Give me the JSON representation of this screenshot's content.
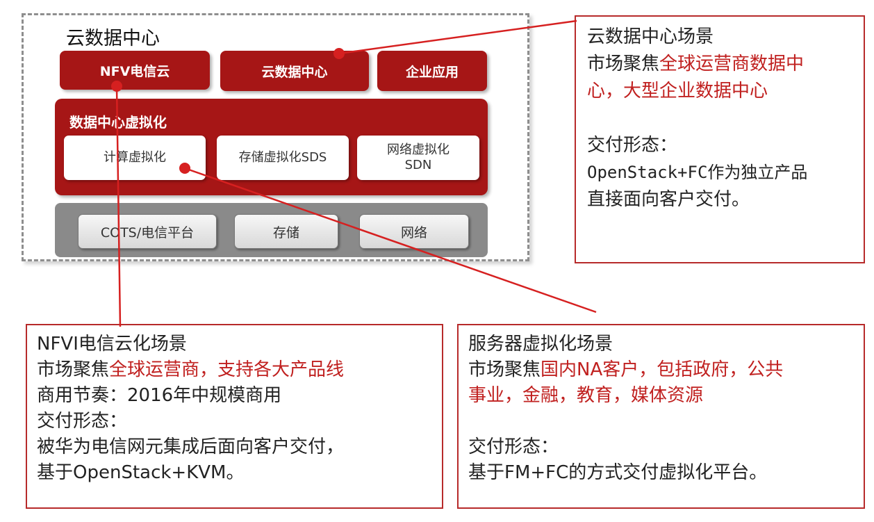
{
  "cloud_dc": {
    "title": "云数据中心",
    "top_buttons": [
      "NFV电信云",
      "云数据中心",
      "企业应用"
    ],
    "virtualization": {
      "title": "数据中心虚拟化",
      "items": [
        "计算虚拟化",
        "存储虚拟化SDS",
        "网络虚拟化",
        "SDN"
      ]
    },
    "infrastructure": [
      "COTS/电信平台",
      "存储",
      "网络"
    ]
  },
  "callout_cloud": {
    "title": "云数据中心场景",
    "market_label": "市场聚焦",
    "market_value_1": "全球运营商数据中",
    "market_value_2": "心，大型企业数据中心",
    "delivery_label": "交付形态：",
    "delivery_1": "OpenStack+FC作为独立产品",
    "delivery_2": "直接面向客户交付。"
  },
  "callout_nfvi": {
    "title": "NFVI电信云化场景",
    "market_label": "市场聚焦",
    "market_value": "全球运营商，支持各大产品线",
    "rhythm": "商用节奏：2016年中规模商用",
    "delivery_label": "交付形态：",
    "delivery_1": "被华为电信网元集成后面向客户交付，",
    "delivery_2": "基于OpenStack+KVM。"
  },
  "callout_server": {
    "title": "服务器虚拟化场景",
    "market_label": "市场聚焦",
    "market_value_1": "国内NA客户，包括政府，公共",
    "market_value_2": "事业，金融，教育，媒体资源",
    "delivery_label": "交付形态：",
    "delivery_1": "基于FM+FC的方式交付虚拟化平台。"
  },
  "colors": {
    "accent_red": "#a61616",
    "text_red": "#c0201f",
    "gray_panel": "#8a8a8a"
  }
}
